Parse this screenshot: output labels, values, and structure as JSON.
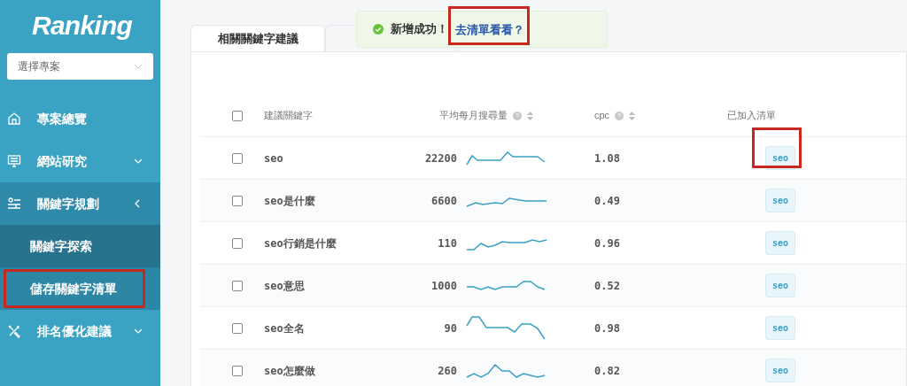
{
  "logo": "Ranking",
  "project_select": {
    "placeholder": "選擇專案"
  },
  "sidebar": {
    "items": [
      {
        "label": "專案總覽",
        "selected": false
      },
      {
        "label": "網站研究",
        "expanded": false,
        "selected": false
      },
      {
        "label": "關鍵字規劃",
        "expanded": true,
        "selected": true,
        "children": [
          {
            "label": "關鍵字探索",
            "selected": true,
            "highlighted": false
          },
          {
            "label": "儲存關鍵字清單",
            "selected": false,
            "highlighted": true
          }
        ]
      },
      {
        "label": "排名優化建議",
        "expanded": false,
        "selected": false
      }
    ]
  },
  "tabs": [
    {
      "label": "相關關鍵字建議",
      "selected": true
    }
  ],
  "toast": {
    "message": "新增成功！",
    "link": "去清單看看？",
    "link_highlighted": true
  },
  "table": {
    "select_all": {
      "checked": false
    },
    "columns": [
      {
        "label": "建議關鍵字"
      },
      {
        "label": "平均每月搜尋量",
        "help": true,
        "sortable": true
      },
      {
        "label": "cpc",
        "help": true,
        "sortable": true
      },
      {
        "label": "已加入清單"
      }
    ],
    "rows": [
      {
        "keyword": "seo",
        "volume": "22200",
        "cpc": "1.08",
        "tag": "seo",
        "checked": false,
        "tag_highlighted": true
      },
      {
        "keyword": "seo是什麼",
        "volume": "6600",
        "cpc": "0.49",
        "tag": "seo",
        "checked": false,
        "tag_highlighted": false
      },
      {
        "keyword": "seo行銷是什麼",
        "volume": "110",
        "cpc": "0.96",
        "tag": "seo",
        "checked": false,
        "tag_highlighted": false
      },
      {
        "keyword": "seo意思",
        "volume": "1000",
        "cpc": "0.52",
        "tag": "seo",
        "checked": false,
        "tag_highlighted": false
      },
      {
        "keyword": "seo全名",
        "volume": "90",
        "cpc": "0.98",
        "tag": "seo",
        "checked": false,
        "tag_highlighted": false
      },
      {
        "keyword": "seo怎麼做",
        "volume": "260",
        "cpc": "0.82",
        "tag": "seo",
        "checked": false,
        "tag_highlighted": false
      }
    ]
  }
}
